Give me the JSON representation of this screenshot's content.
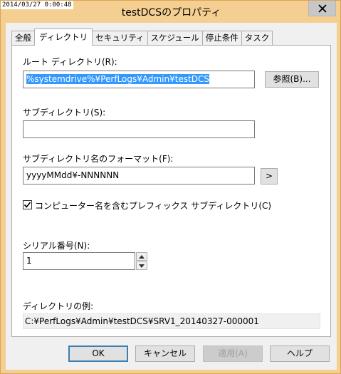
{
  "window": {
    "timestamp": "2014/03/27 0:00:48",
    "title": "testDCSのプロパティ"
  },
  "tabs": [
    {
      "label": "全般",
      "active": false
    },
    {
      "label": "ディレクトリ",
      "active": true
    },
    {
      "label": "セキュリティ",
      "active": false
    },
    {
      "label": "スケジュール",
      "active": false
    },
    {
      "label": "停止条件",
      "active": false
    },
    {
      "label": "タスク",
      "active": false
    }
  ],
  "root_directory": {
    "label": "ルート ディレクトリ(R):",
    "value": "%systemdrive%¥PerfLogs¥Admin¥testDCS",
    "browse_label": "参照(B)..."
  },
  "subdirectory": {
    "label": "サブディレクトリ(S):",
    "value": ""
  },
  "subdirectory_format": {
    "label": "サブディレクトリ名のフォーマット(F):",
    "value": "yyyyMMdd¥-NNNNNN",
    "arrow_label": ">"
  },
  "prefix_checkbox": {
    "label": "コンピューター名を含むプレフィックス サブディレクトリ(C)",
    "checked": true
  },
  "serial_number": {
    "label": "シリアル番号(N):",
    "value": "1"
  },
  "example": {
    "label": "ディレクトリの例:",
    "value": "C:¥PerfLogs¥Admin¥testDCS¥SRV1_20140327-000001"
  },
  "buttons": {
    "ok": "OK",
    "cancel": "キャンセル",
    "apply": "適用(A)",
    "help": "ヘルプ"
  },
  "colors": {
    "frame": "#f5cf91",
    "selection": "#3399ff",
    "default_button_border": "#3c7fb1"
  }
}
